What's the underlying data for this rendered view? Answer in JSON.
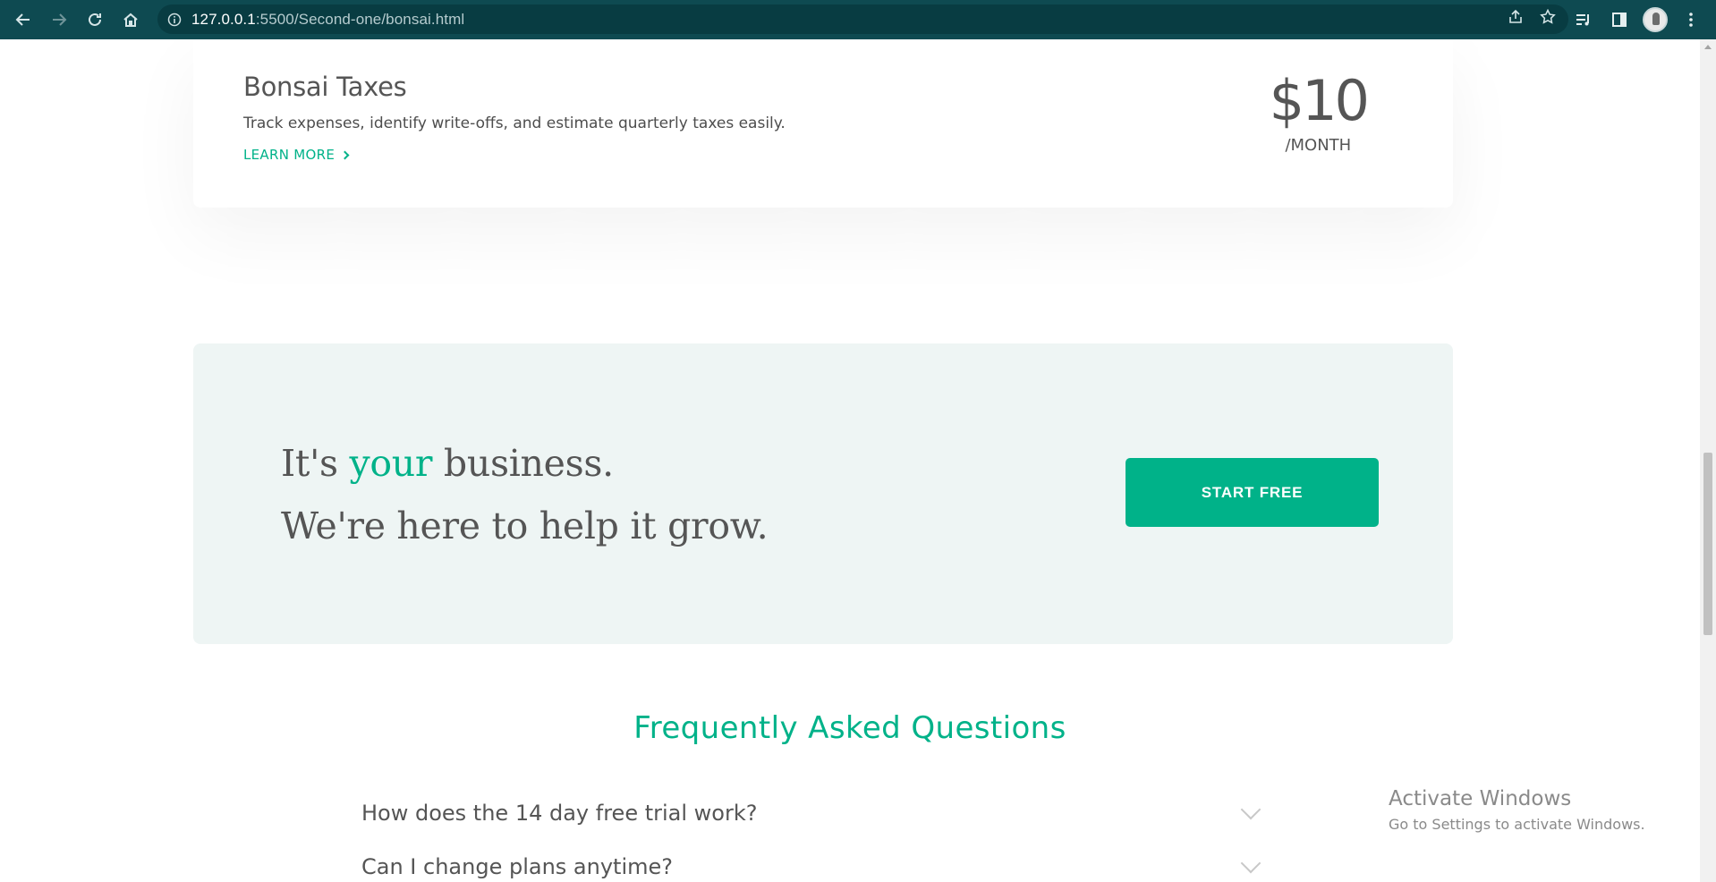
{
  "browser": {
    "url_host": "127.0.0.1",
    "url_path": ":5500/Second-one/bonsai.html"
  },
  "tax_card": {
    "title": "Bonsai Taxes",
    "description": "Track expenses, identify write-offs, and estimate quarterly taxes easily.",
    "learn_more": "LEARN MORE",
    "price": "$10",
    "price_unit": "/MONTH"
  },
  "cta": {
    "line1_before": "It's",
    "line1_accent": "your",
    "line1_after": "business.",
    "line2": "We're here to help it grow.",
    "button": "START FREE"
  },
  "faq": {
    "title": "Frequently Asked Questions",
    "items": [
      "How does the 14 day free trial work?",
      "Can I change plans anytime?"
    ]
  },
  "watermark": {
    "title": "Activate Windows",
    "subtitle": "Go to Settings to activate Windows."
  },
  "colors": {
    "accent": "#00b289",
    "chrome": "#0e4a51",
    "cta_background": "#eef5f4"
  },
  "icons": [
    "back-arrow-icon",
    "forward-arrow-icon",
    "reload-icon",
    "home-icon",
    "info-icon",
    "share-icon",
    "star-icon",
    "reading-list-icon",
    "side-panel-icon",
    "menu-icon"
  ]
}
